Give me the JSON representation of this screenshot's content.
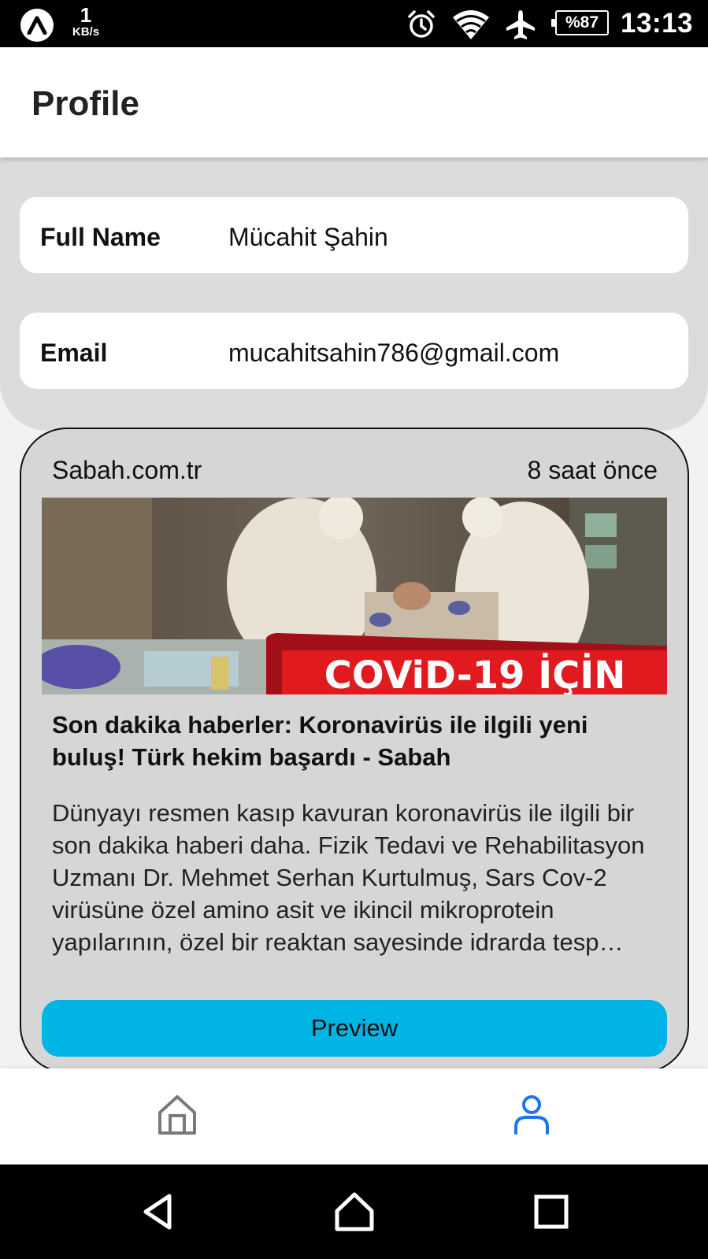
{
  "status_bar": {
    "speed_value": "1",
    "speed_unit": "KB/s",
    "battery": "%87",
    "time": "13:13",
    "icons": [
      "app-logo-icon",
      "alarm-icon",
      "wifi-icon",
      "airplane-icon",
      "battery-icon"
    ]
  },
  "header": {
    "title": "Profile"
  },
  "profile": {
    "full_name_label": "Full Name",
    "full_name_value": "Mücahit Şahin",
    "email_label": "Email",
    "email_value": "mucahitsahin786@gmail.com"
  },
  "news": {
    "source": "Sabah.com.tr",
    "time_ago": "8 saat önce",
    "image_banner": "COViD-19 İÇİN",
    "title": "Son dakika haberler: Koronavirüs ile ilgili yeni buluş! Türk hekim başardı - Sabah",
    "description": "Dünyayı resmen kasıp kavuran koronavirüs ile ilgili bir son dakika haberi daha. Fizik Tedavi ve Rehabilitasyon Uzmanı Dr. Mehmet Serhan Kurtulmuş, Sars Cov-2 virüsüne özel amino asit ve ikincil mikroprotein yapılarının, özel bir reaktan sayesinde idrarda tesp…",
    "preview_label": "Preview"
  },
  "bottom_nav": {
    "items": [
      {
        "name": "home",
        "icon": "home-icon",
        "active": false
      },
      {
        "name": "profile",
        "icon": "person-icon",
        "active": true
      }
    ],
    "active_color": "#1976f0",
    "inactive_color": "#7a7a7a"
  },
  "system_nav": {
    "icons": [
      "back-icon",
      "home-icon",
      "recents-icon"
    ]
  },
  "colors": {
    "preview_button": "#00b4e6",
    "panel_background": "#dcdcdc",
    "card_background": "#d6d6d6"
  }
}
